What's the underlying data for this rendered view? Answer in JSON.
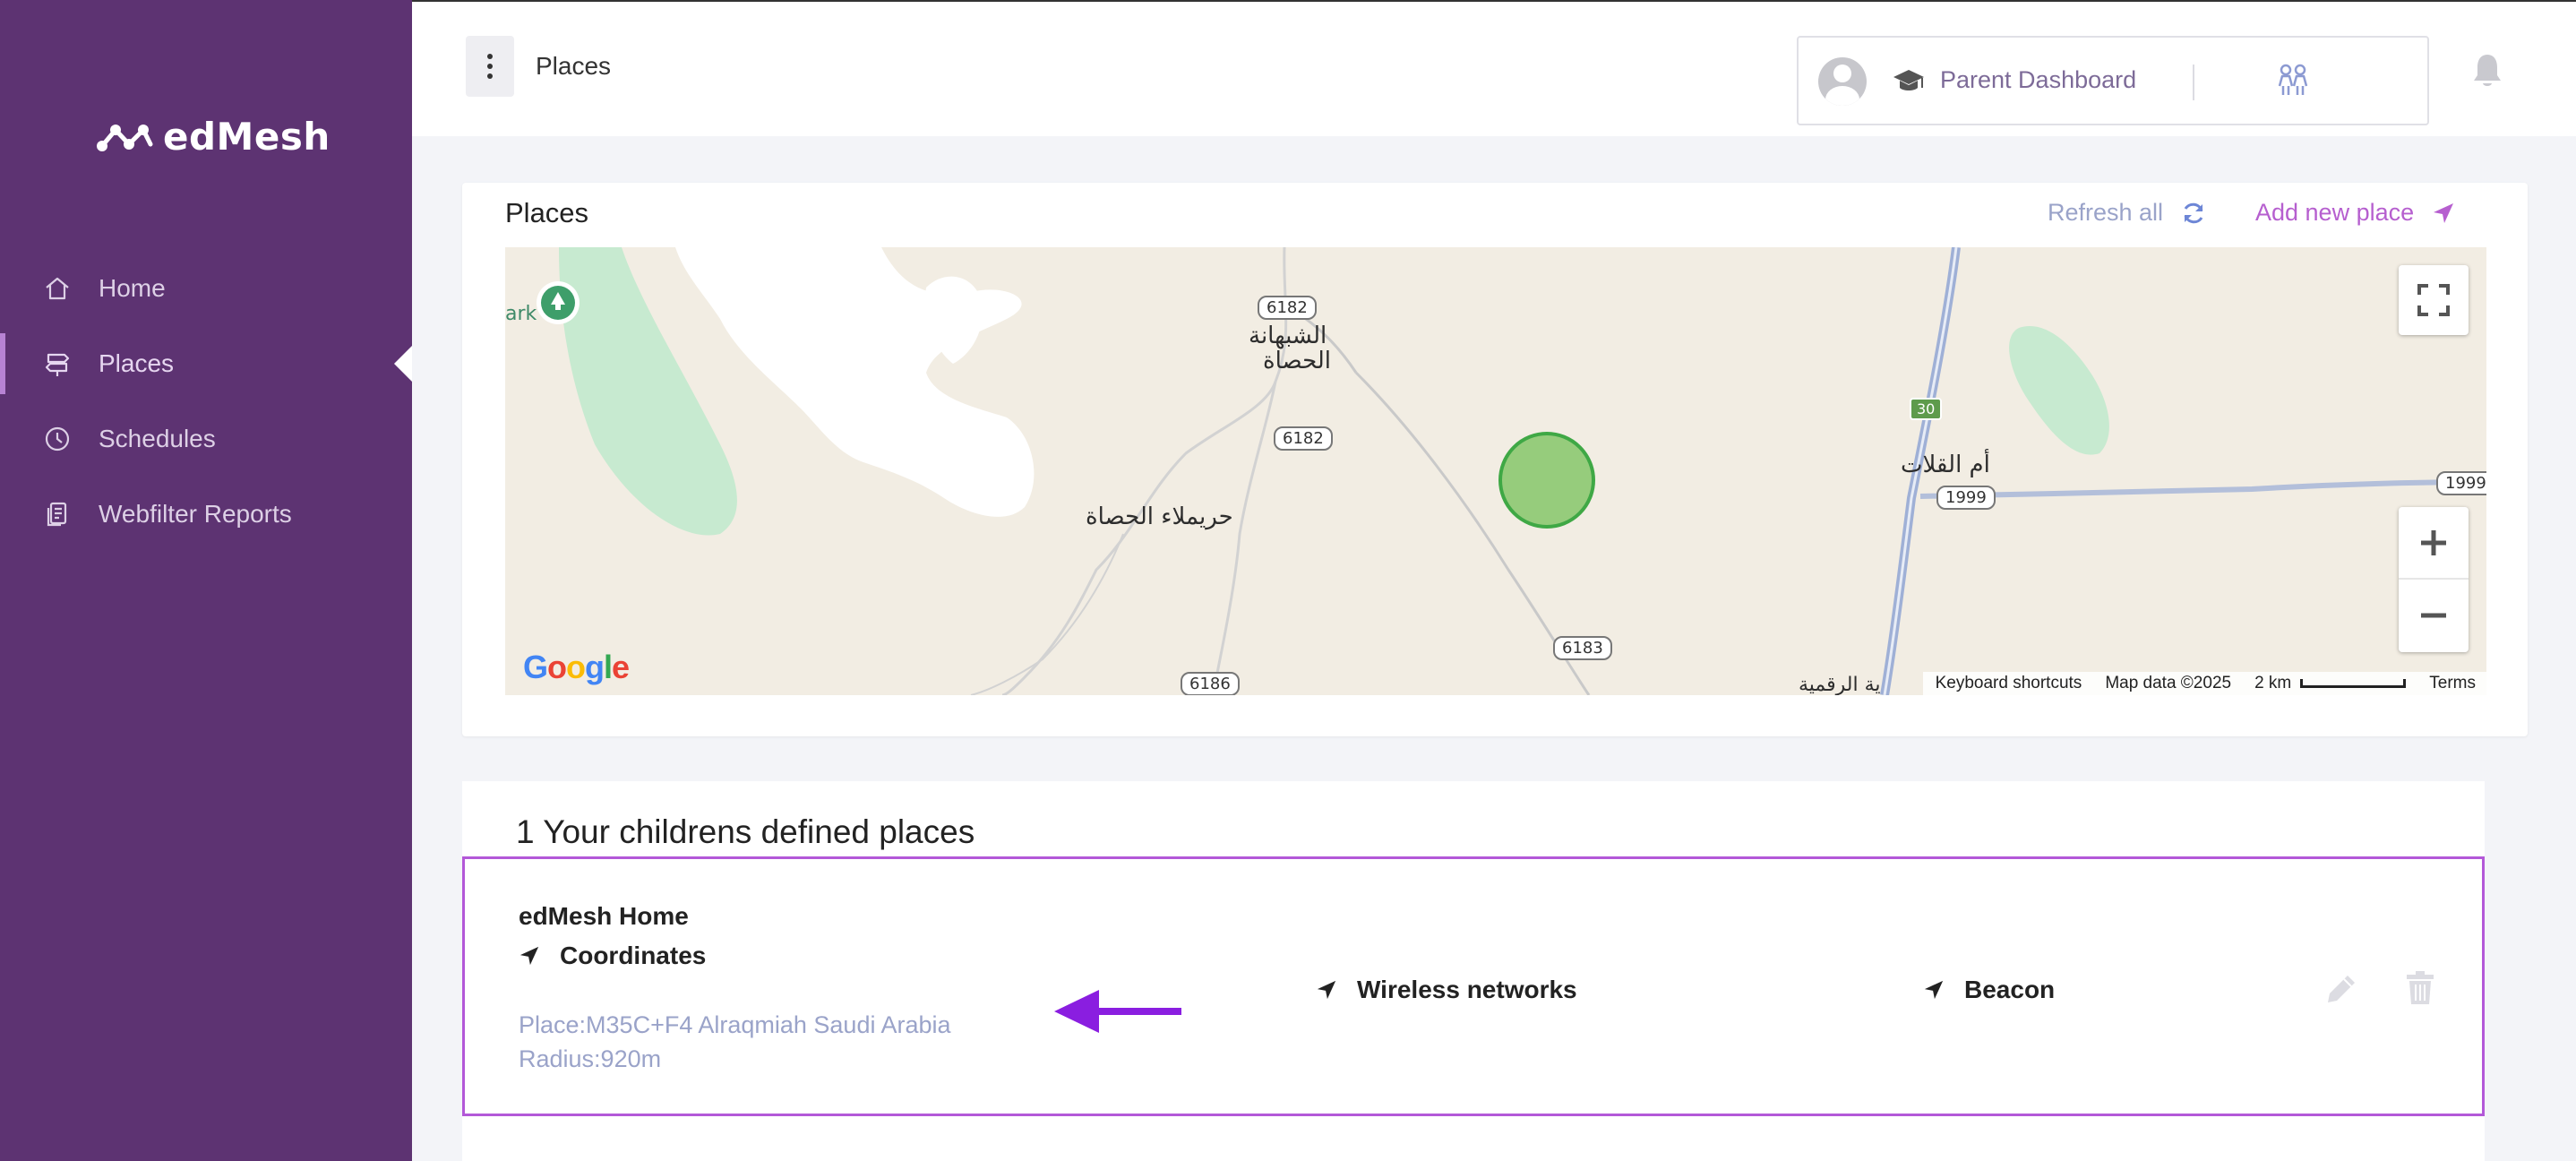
{
  "brand": {
    "name": "edMesh"
  },
  "sidebar": {
    "items": [
      {
        "label": "Home",
        "icon": "home-icon"
      },
      {
        "label": "Places",
        "icon": "signpost-icon",
        "active": true
      },
      {
        "label": "Schedules",
        "icon": "clock-icon"
      },
      {
        "label": "Webfilter Reports",
        "icon": "report-icon"
      }
    ]
  },
  "header": {
    "title": "Places",
    "dashboard_label": "Parent Dashboard"
  },
  "map_card": {
    "title": "Places",
    "refresh_label": "Refresh all",
    "add_label": "Add new place",
    "map": {
      "labels": {
        "town1": "الشبهانة",
        "town1b": "الحصاة",
        "town2": "حريملاء الحصاة",
        "town3": "أم القلات",
        "park": "ark",
        "edge_text": "ية الرقمية"
      },
      "roads": [
        "6182",
        "6182",
        "6183",
        "6186",
        "1999",
        "1999",
        "30"
      ],
      "footer": {
        "shortcuts": "Keyboard shortcuts",
        "map_data": "Map data ©2025",
        "scale": "2 km",
        "terms": "Terms"
      },
      "google": "Google"
    }
  },
  "places_list": {
    "title": "1 Your childrens defined places",
    "places": [
      {
        "name": "edMesh Home",
        "coordinates_label": "Coordinates",
        "place_text": "Place:M35C+F4 Alraqmiah Saudi Arabia",
        "radius_text": "Radius:920m",
        "wireless_label": "Wireless networks",
        "beacon_label": "Beacon"
      }
    ]
  },
  "colors": {
    "sidebar": "#5d3372",
    "accent": "#b65fcf",
    "muted": "#9aa3c9",
    "highlight_border": "#b358d8",
    "annotation_arrow": "#8a1ee0"
  }
}
